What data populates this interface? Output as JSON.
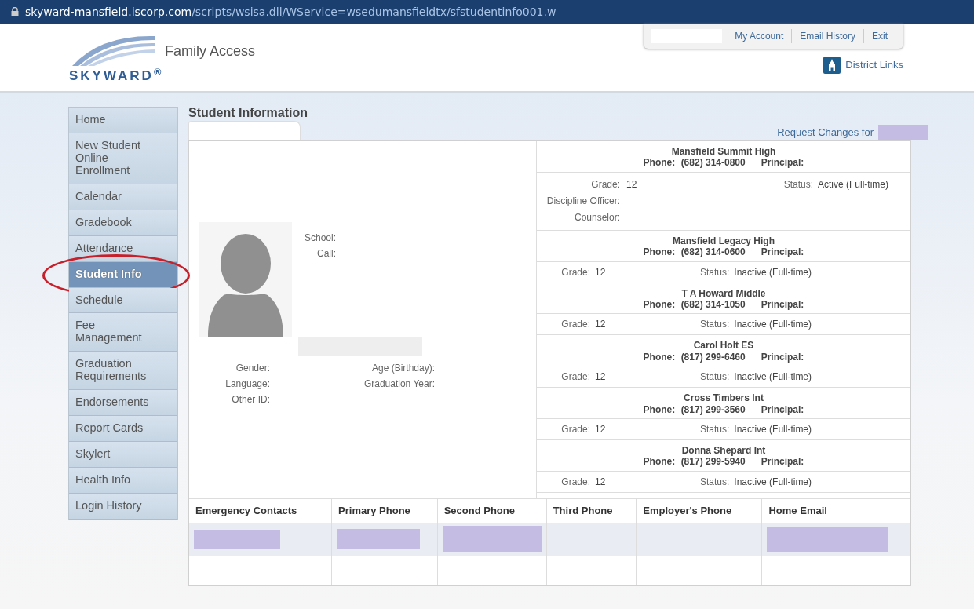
{
  "address_bar": {
    "domain": "skyward-mansfield.iscorp.com",
    "path": "/scripts/wsisa.dll/WService=wsedumansfieldtx/sfstudentinfo001.w"
  },
  "header": {
    "logo": "SKYWARD$^{®}$",
    "app_title": "Family Access",
    "top_links": [
      "My Account",
      "Email History",
      "Exit"
    ],
    "district_links": "District Links"
  },
  "sidebar": {
    "items": [
      {
        "label": "Home",
        "selected": false,
        "annotated": false
      },
      {
        "label": "New Student Online Enrollment",
        "selected": false,
        "annotated": false
      },
      {
        "label": "Calendar",
        "selected": false,
        "annotated": false
      },
      {
        "label": "Gradebook",
        "selected": false,
        "annotated": false
      },
      {
        "label": "Attendance",
        "selected": false,
        "annotated": false
      },
      {
        "label": "Student Info",
        "selected": true,
        "annotated": true
      },
      {
        "label": "Schedule",
        "selected": false,
        "annotated": false
      },
      {
        "label": "Fee Management",
        "selected": false,
        "annotated": false
      },
      {
        "label": "Graduation Requirements",
        "selected": false,
        "annotated": false
      },
      {
        "label": "Endorsements",
        "selected": false,
        "annotated": false
      },
      {
        "label": "Report Cards",
        "selected": false,
        "annotated": false
      },
      {
        "label": "Skylert",
        "selected": false,
        "annotated": false
      },
      {
        "label": "Health Info",
        "selected": false,
        "annotated": false
      },
      {
        "label": "Login History",
        "selected": false,
        "annotated": false
      }
    ]
  },
  "page_title": "Student Information",
  "request_changes": {
    "label": "Request Changes for",
    "redacted": true
  },
  "student": {
    "school_label": "School:",
    "call_label": "Call:",
    "details_left": [
      "Gender:",
      "Language:",
      "Other ID:"
    ],
    "details_right": [
      "Age (Birthday):",
      "Graduation Year:"
    ]
  },
  "schools": [
    {
      "kind": "current",
      "name": "Mansfield Summit High",
      "phone_label": "Phone:",
      "phone": "(682) 314-0800",
      "principal_label": "Principal:",
      "grade_label": "Grade:",
      "grade": "12",
      "status_label": "Status:",
      "status": "Active (Full-time)",
      "extra_labels": [
        "Discipline Officer:",
        "Counselor:"
      ]
    },
    {
      "kind": "previous",
      "name": "Mansfield Legacy High",
      "phone_label": "Phone:",
      "phone": "(682) 314-0600",
      "principal_label": "Principal:",
      "grade_label": "Grade:",
      "grade": "12",
      "status_label": "Status:",
      "status": "Inactive (Full-time)"
    },
    {
      "kind": "previous",
      "name": "T A Howard Middle",
      "phone_label": "Phone:",
      "phone": "(682) 314-1050",
      "principal_label": "Principal:",
      "grade_label": "Grade:",
      "grade": "12",
      "status_label": "Status:",
      "status": "Inactive (Full-time)"
    },
    {
      "kind": "previous",
      "name": "Carol Holt ES",
      "phone_label": "Phone:",
      "phone": "(817) 299-6460",
      "principal_label": "Principal:",
      "grade_label": "Grade:",
      "grade": "12",
      "status_label": "Status:",
      "status": "Inactive (Full-time)"
    },
    {
      "kind": "previous",
      "name": "Cross Timbers Int",
      "phone_label": "Phone:",
      "phone": "(817) 299-3560",
      "principal_label": "Principal:",
      "grade_label": "Grade:",
      "grade": "12",
      "status_label": "Status:",
      "status": "Inactive (Full-time)"
    },
    {
      "kind": "previous",
      "name": "Donna Shepard Int",
      "phone_label": "Phone:",
      "phone": "(817) 299-5940",
      "principal_label": "Principal:",
      "grade_label": "Grade:",
      "grade": "12",
      "status_label": "Status:",
      "status": "Inactive (Full-time)"
    }
  ],
  "contacts_table": {
    "columns": [
      "Emergency Contacts",
      "Primary Phone",
      "Second Phone",
      "Third Phone",
      "Employer's Phone",
      "Home Email"
    ],
    "rows": [
      {
        "shaded": true,
        "cells": [
          {
            "redacted": true
          },
          {
            "redacted": true
          },
          {
            "redacted": true
          },
          {
            "redacted": false
          },
          {
            "redacted": false
          },
          {
            "redacted": true
          }
        ]
      },
      {
        "shaded": false,
        "cells": [
          {
            "redacted": false
          },
          {
            "redacted": false
          },
          {
            "redacted": false
          },
          {
            "redacted": false
          },
          {
            "redacted": false
          },
          {
            "redacted": false
          }
        ]
      }
    ]
  }
}
